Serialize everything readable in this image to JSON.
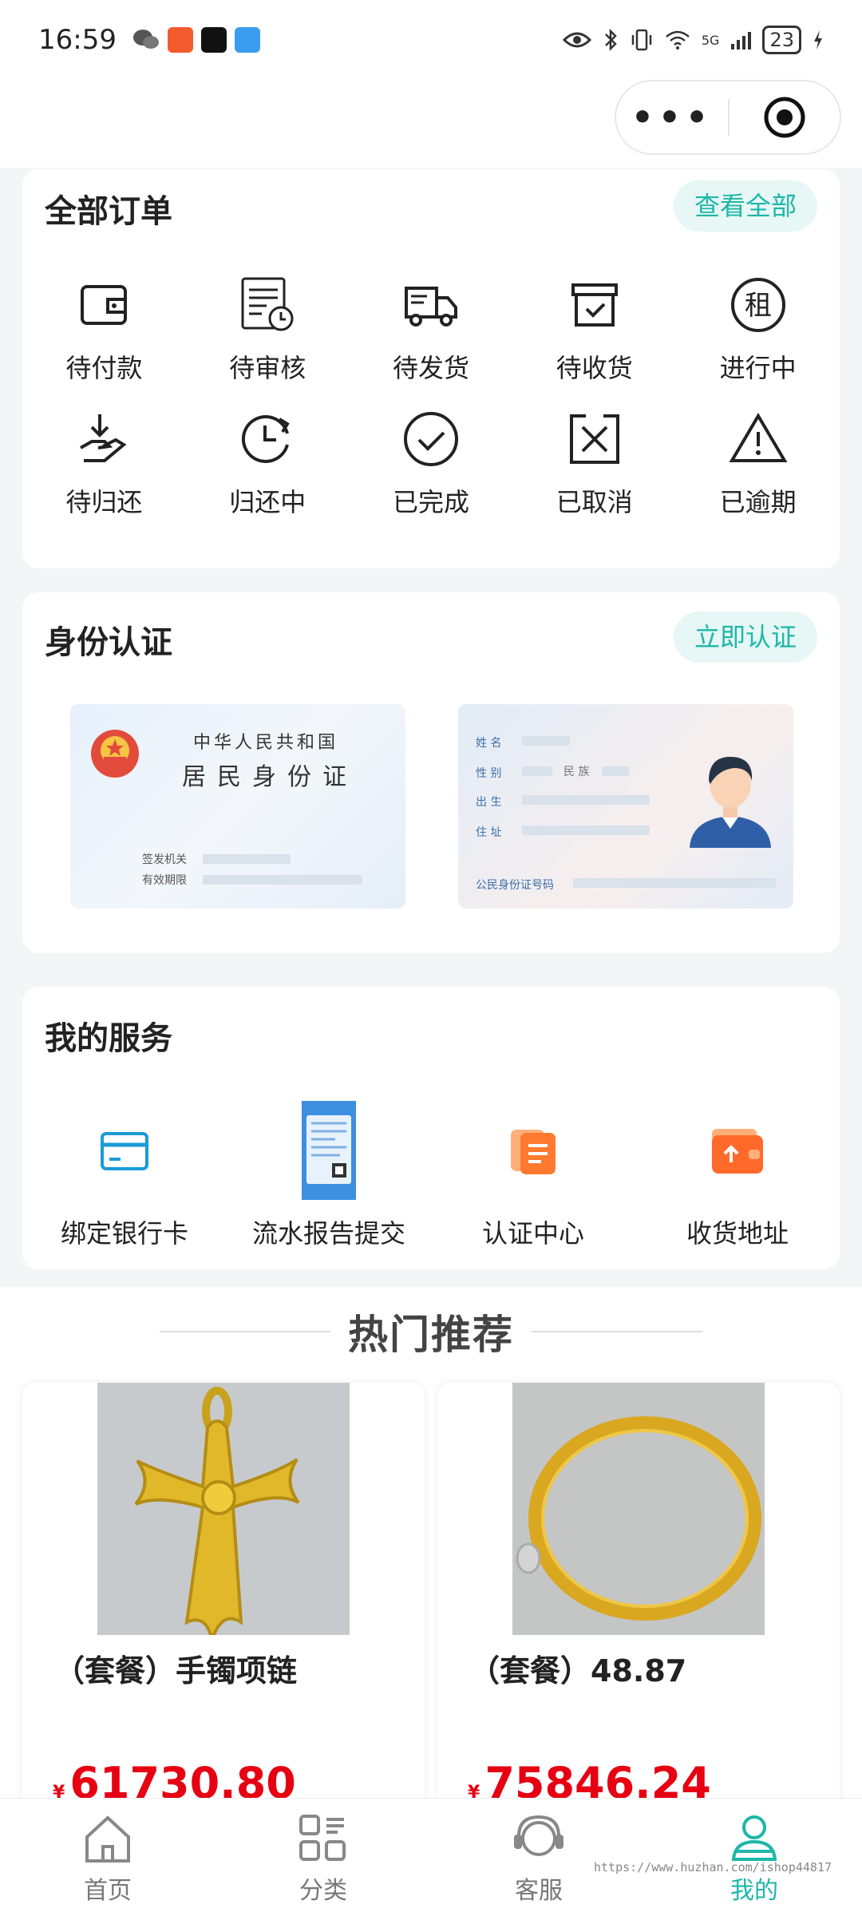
{
  "status_bar": {
    "time": "16:59",
    "network": "5G",
    "battery": "23"
  },
  "header": {
    "more_label": "•••"
  },
  "orders": {
    "title": "全部订单",
    "view_all": "查看全部",
    "items": [
      {
        "label": "待付款",
        "icon": "wallet-icon"
      },
      {
        "label": "待审核",
        "icon": "review-document-icon"
      },
      {
        "label": "待发货",
        "icon": "delivery-truck-icon"
      },
      {
        "label": "待收货",
        "icon": "package-check-icon"
      },
      {
        "label": "进行中",
        "icon": "rent-badge-icon",
        "glyph": "租"
      },
      {
        "label": "待归还",
        "icon": "return-hand-icon"
      },
      {
        "label": "归还中",
        "icon": "clock-returning-icon"
      },
      {
        "label": "已完成",
        "icon": "check-circle-icon"
      },
      {
        "label": "已取消",
        "icon": "cancel-box-icon"
      },
      {
        "label": "已逾期",
        "icon": "warning-triangle-icon"
      }
    ]
  },
  "identity": {
    "title": "身份认证",
    "verify_now": "立即认证",
    "front": {
      "country": "中华人民共和国",
      "card_name": "居民身份证",
      "issuer_label": "签发机关",
      "validity_label": "有效期限"
    },
    "back": {
      "name_label": "姓 名",
      "gender_label": "性 别",
      "ethnicity_label": "民 族",
      "birth_label": "出 生",
      "address_label": "住 址",
      "id_number_label": "公民身份证号码"
    }
  },
  "services": {
    "title": "我的服务",
    "items": [
      {
        "label": "绑定银行卡",
        "icon": "bank-card-icon"
      },
      {
        "label": "流水报告提交",
        "icon": "bank-statement-icon"
      },
      {
        "label": "认证中心",
        "icon": "certification-icon"
      },
      {
        "label": "收货地址",
        "icon": "address-wallet-icon"
      }
    ]
  },
  "hot": {
    "title": "热门推荐",
    "products": [
      {
        "name": "（套餐）手镯项链",
        "price_symbol": "¥",
        "price": "61730.80"
      },
      {
        "name": "（套餐）48.87",
        "price_symbol": "¥",
        "price": "75846.24"
      }
    ]
  },
  "tabbar": {
    "items": [
      {
        "label": "首页",
        "icon": "home-icon"
      },
      {
        "label": "分类",
        "icon": "category-icon"
      },
      {
        "label": "客服",
        "icon": "customer-service-icon"
      },
      {
        "label": "我的",
        "icon": "profile-icon",
        "active": true
      }
    ]
  },
  "watermark": "https://www.huzhan.com/ishop44817",
  "colors": {
    "accent": "#1db7a8",
    "price": "#e60012",
    "pill_bg": "#e6f7f5"
  }
}
